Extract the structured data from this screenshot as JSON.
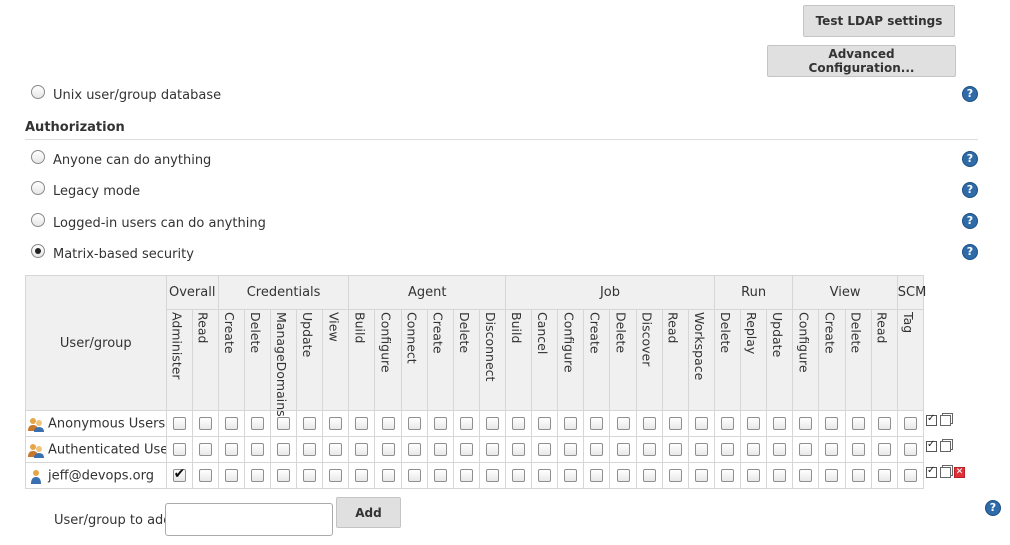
{
  "buttons": {
    "test_ldap": "Test LDAP settings",
    "advanced": "Advanced Configuration...",
    "add": "Add"
  },
  "security_realm": {
    "unix": "Unix user/group database"
  },
  "authorization": {
    "title": "Authorization",
    "options": [
      {
        "label": "Anyone can do anything",
        "selected": false
      },
      {
        "label": "Legacy mode",
        "selected": false
      },
      {
        "label": "Logged-in users can do anything",
        "selected": false
      },
      {
        "label": "Matrix-based security",
        "selected": true
      }
    ]
  },
  "matrix": {
    "user_group_header": "User/group",
    "groups": [
      {
        "name": "Overall",
        "span": 2
      },
      {
        "name": "Credentials",
        "span": 5
      },
      {
        "name": "Agent",
        "span": 6
      },
      {
        "name": "Job",
        "span": 8
      },
      {
        "name": "Run",
        "span": 3
      },
      {
        "name": "View",
        "span": 4
      },
      {
        "name": "SCM",
        "span": 1
      }
    ],
    "permissions": [
      "Administer",
      "Read",
      "Create",
      "Delete",
      "ManageDomains",
      "Update",
      "View",
      "Build",
      "Configure",
      "Connect",
      "Create",
      "Delete",
      "Disconnect",
      "Build",
      "Cancel",
      "Configure",
      "Create",
      "Delete",
      "Discover",
      "Read",
      "Workspace",
      "Delete",
      "Replay",
      "Update",
      "Configure",
      "Create",
      "Delete",
      "Read",
      "Tag"
    ],
    "rows": [
      {
        "name": "Anonymous Users",
        "icon": "group-icon",
        "checked": [],
        "deletable": false
      },
      {
        "name": "Authenticated Users",
        "icon": "group-icon",
        "checked": [],
        "deletable": false
      },
      {
        "name": "jeff@devops.org",
        "icon": "user-icon",
        "checked": [
          0
        ],
        "deletable": true
      }
    ]
  },
  "add_user": {
    "label": "User/group to add:",
    "value": ""
  },
  "colors": {
    "help": "#2e6ba8",
    "delete": "#e0313a",
    "header_bg": "#f0f0f0"
  }
}
